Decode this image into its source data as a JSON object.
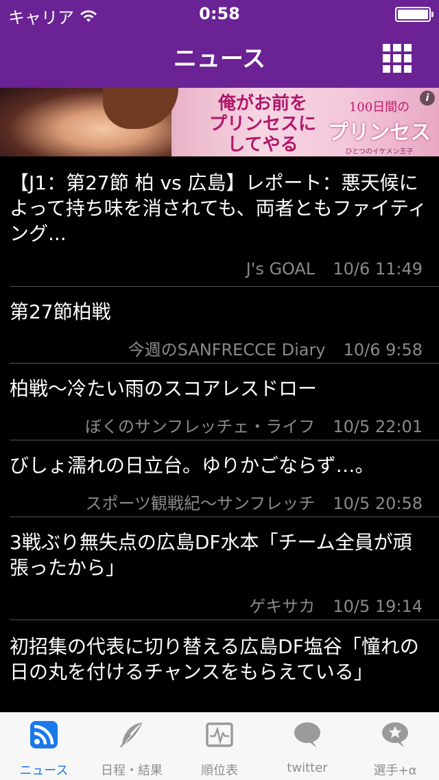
{
  "status_bar": {
    "carrier": "キャリア",
    "time": "0:58"
  },
  "nav": {
    "title": "ニュース"
  },
  "ad": {
    "copy_lines": [
      "俺がお前を",
      "プリンセスに",
      "してやる"
    ],
    "logo_top": "100日間の",
    "logo_main": "プリンセス",
    "logo_sub": "ひとつのイケメン王子",
    "info": "i"
  },
  "news": [
    {
      "title": "【J1：第27節 柏 vs 広島】レポート：悪天候によって持ち味を消されても、両者ともファイティング...",
      "source": "J's GOAL",
      "date": "10/6 11:49"
    },
    {
      "title": "第27節柏戦",
      "source": "今週のSANFRECCE Diary",
      "date": "10/6 9:58"
    },
    {
      "title": "柏戦〜冷たい雨のスコアレスドロー",
      "source": "ぼくのサンフレッチェ・ライフ",
      "date": "10/5 22:01"
    },
    {
      "title": "びしょ濡れの日立台。ゆりかごならず…。",
      "source": "スポーツ観戦紀〜サンフレッチ",
      "date": "10/5 20:58"
    },
    {
      "title": "3戦ぶり無失点の広島DF水本「チーム全員が頑張ったから」",
      "source": "ゲキサカ",
      "date": "10/5 19:14"
    },
    {
      "title": "初招集の代表に切り替える広島DF塩谷「憧れの日の丸を付けるチャンスをもらえている」",
      "source": "",
      "date": ""
    }
  ],
  "tabs": [
    {
      "label": "ニュース",
      "icon": "rss-icon",
      "active": true
    },
    {
      "label": "日程・結果",
      "icon": "feather-icon",
      "active": false
    },
    {
      "label": "順位表",
      "icon": "chart-icon",
      "active": false
    },
    {
      "label": "twitter",
      "icon": "speech-bubble-icon",
      "active": false
    },
    {
      "label": "選手+α",
      "icon": "star-bubble-icon",
      "active": false
    }
  ],
  "colors": {
    "nav_bg": "#6a2294",
    "tab_active": "#1a78e8",
    "tab_inactive": "#8e8e8e"
  }
}
